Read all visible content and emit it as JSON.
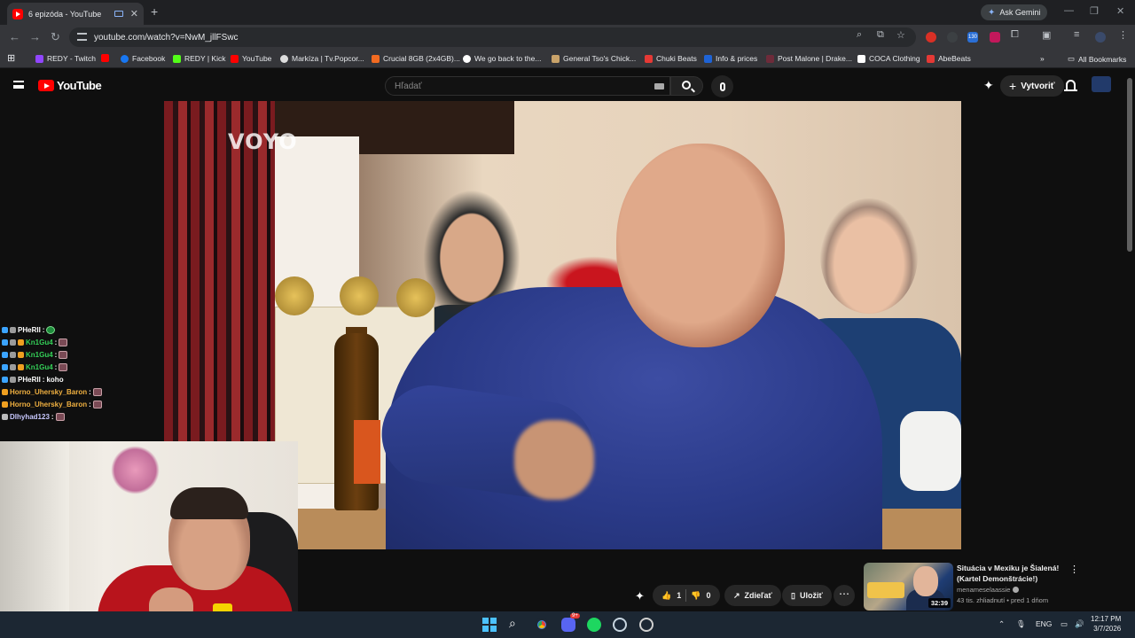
{
  "browser": {
    "tab": {
      "title": "6 epizóda - YouTube"
    },
    "ask_gemini": "Ask Gemini",
    "url": "youtube.com/watch?v=NwM_jllFSwc",
    "bookmarks": [
      {
        "label": "REDY - Twitch",
        "color": "#9146ff"
      },
      {
        "label": "",
        "color": "#ff0000"
      },
      {
        "label": "Facebook",
        "color": "#1877f2"
      },
      {
        "label": "REDY | Kick",
        "color": "#53fc18"
      },
      {
        "label": "YouTube",
        "color": "#ff0000"
      },
      {
        "label": "Markíza | Tv.Popcor...",
        "color": "#dddddd"
      },
      {
        "label": "Crucial 8GB (2x4GB)...",
        "color": "#f26b21"
      },
      {
        "label": "We go back to the...",
        "color": "#ffffff"
      },
      {
        "label": "General Tso's Chick...",
        "color": "#c9a36a"
      },
      {
        "label": "Chuki Beats",
        "color": "#e53935"
      },
      {
        "label": "Info & prices",
        "color": "#1e63d6"
      },
      {
        "label": "Post Malone | Drake...",
        "color": "#6e2b3a"
      },
      {
        "label": "COCA Clothing",
        "color": "#ffffff"
      },
      {
        "label": "AbeBeats",
        "color": "#e53935"
      }
    ],
    "all_bookmarks": "All Bookmarks",
    "ext_badge": "130"
  },
  "youtube": {
    "logo_text": "YouTube",
    "search_placeholder": "Hľadať",
    "create_label": "Vytvoriť",
    "video_watermark": "VOYO",
    "actions": {
      "like_count": "1",
      "dislike_count": "0",
      "share_label": "Zdieľať",
      "save_label": "Uložiť"
    },
    "recommended": {
      "title": "Situácia v Mexiku je Šialená! (Kartel Demonštrácie!)",
      "channel": "menameselaassie",
      "meta": "43 tis. zhliadnutí • pred 1 dňom",
      "duration": "32:39"
    }
  },
  "chat": [
    {
      "user": "PHeRII",
      "user_color": "#ffffff",
      "message": "",
      "emote": "green",
      "badges": [
        "#3ba4ff",
        "#9b9b9b"
      ]
    },
    {
      "user": "Kn1Gu4",
      "user_color": "#34d058",
      "message": "",
      "emote": "pink",
      "badges": [
        "#3ba4ff",
        "#9b9b9b",
        "#f0a020"
      ]
    },
    {
      "user": "Kn1Gu4",
      "user_color": "#34d058",
      "message": "",
      "emote": "pink",
      "badges": [
        "#3ba4ff",
        "#9b9b9b",
        "#f0a020"
      ]
    },
    {
      "user": "Kn1Gu4",
      "user_color": "#34d058",
      "message": "",
      "emote": "pink",
      "badges": [
        "#3ba4ff",
        "#9b9b9b",
        "#f0a020"
      ]
    },
    {
      "user": "PHeRII",
      "user_color": "#ffffff",
      "message": "koho",
      "emote": "",
      "badges": [
        "#3ba4ff",
        "#9b9b9b"
      ]
    },
    {
      "user": "Horno_Uhersky_Baron",
      "user_color": "#f0b040",
      "message": "",
      "emote": "pink",
      "badges": [
        "#f0a020"
      ]
    },
    {
      "user": "Horno_Uhersky_Baron",
      "user_color": "#f0b040",
      "message": "",
      "emote": "pink",
      "badges": [
        "#f0a020"
      ]
    },
    {
      "user": "Dlhyhad123",
      "user_color": "#c9c9ff",
      "message": "",
      "emote": "pink",
      "badges": [
        "#bbbbbb"
      ]
    }
  ],
  "taskbar": {
    "lang": "ENG",
    "time": "12:17 PM",
    "date": "3/7/2026",
    "discord_badge": "9+"
  }
}
